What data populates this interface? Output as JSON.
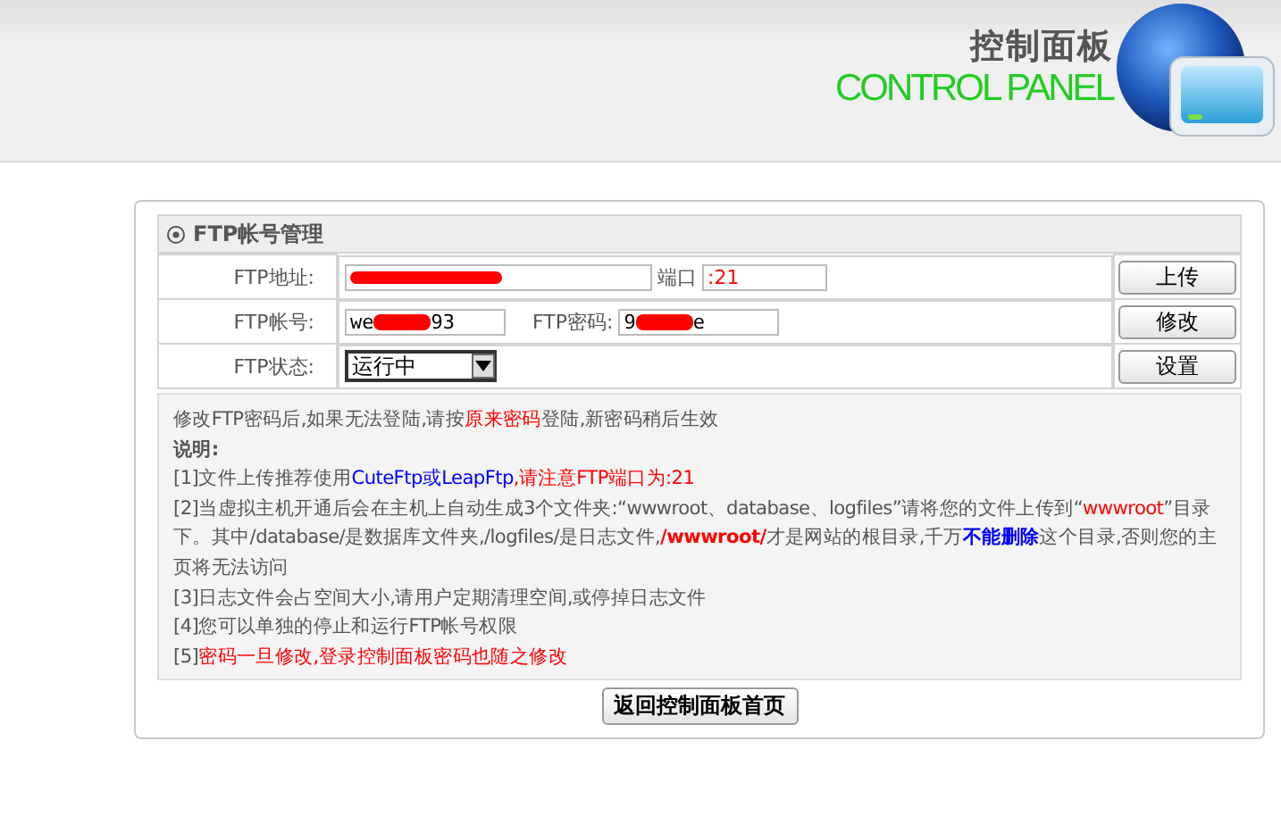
{
  "header": {
    "title_cn": "控制面板",
    "title_en": "CONTROL PANEL"
  },
  "section": {
    "title": "FTP帐号管理"
  },
  "rows": [
    {
      "kind": "address",
      "label": "FTP地址:",
      "redacted": true,
      "port_label": "端口",
      "port_value": ":21",
      "button": "上传"
    },
    {
      "kind": "account",
      "label": "FTP帐号:",
      "value_start": "we",
      "value_end": "93",
      "redacted": true,
      "password_label": "FTP密码:",
      "password_start": "9",
      "password_end": "e",
      "button": "修改"
    },
    {
      "kind": "status",
      "label": "FTP状态:",
      "select_value": "运行中",
      "button": "设置"
    }
  ],
  "notes": [
    [
      {
        "text": "修改FTP密码后,如果无法登陆,请按",
        "color": "#555555"
      },
      {
        "text": "原来密码",
        "color": "#ff0000"
      },
      {
        "text": "登陆,新密码稍后生效",
        "color": "#555555"
      }
    ],
    [
      {
        "text": "说明:",
        "color": "#555555",
        "bold": true
      }
    ],
    [
      {
        "text": "[1]文件上传推荐使用",
        "color": "#555555"
      },
      {
        "text": "CuteFtp或LeapFtp",
        "color": "#0000ff"
      },
      {
        "text": ",请注意FTP端口为:21",
        "color": "#ff0000"
      }
    ],
    [
      {
        "text": "[2]当虚拟主机开通后会在主机上自动生成3个文件夹:“wwwroot、database、logfiles”请将您的文件上传到“",
        "color": "#555555"
      },
      {
        "text": "wwwroot",
        "color": "#ff0000"
      },
      {
        "text": "”目录下。其中/database/是数据库文件夹,/logfiles/是日志文件,",
        "color": "#555555"
      },
      {
        "text": "/wwwroot/",
        "color": "#ff0000",
        "bold": true
      },
      {
        "text": "才是网站的根目录,千万",
        "color": "#555555"
      },
      {
        "text": "不能删除",
        "color": "#0000ff",
        "bold": true
      },
      {
        "text": "这个目录,否则您的主页将无法访问",
        "color": "#555555"
      }
    ],
    [
      {
        "text": "[3]日志文件会占空间大小,请用户定期清理空间,或停掉日志文件",
        "color": "#555555"
      }
    ],
    [
      {
        "text": "[4]您可以单独的停止和运行FTP帐号权限",
        "color": "#555555"
      }
    ],
    [
      {
        "text": "[5]",
        "color": "#555555"
      },
      {
        "text": "密码一旦修改,登录控制面板密码也随之修改",
        "color": "#ff0000"
      }
    ]
  ],
  "back_button": "返回控制面板首页"
}
